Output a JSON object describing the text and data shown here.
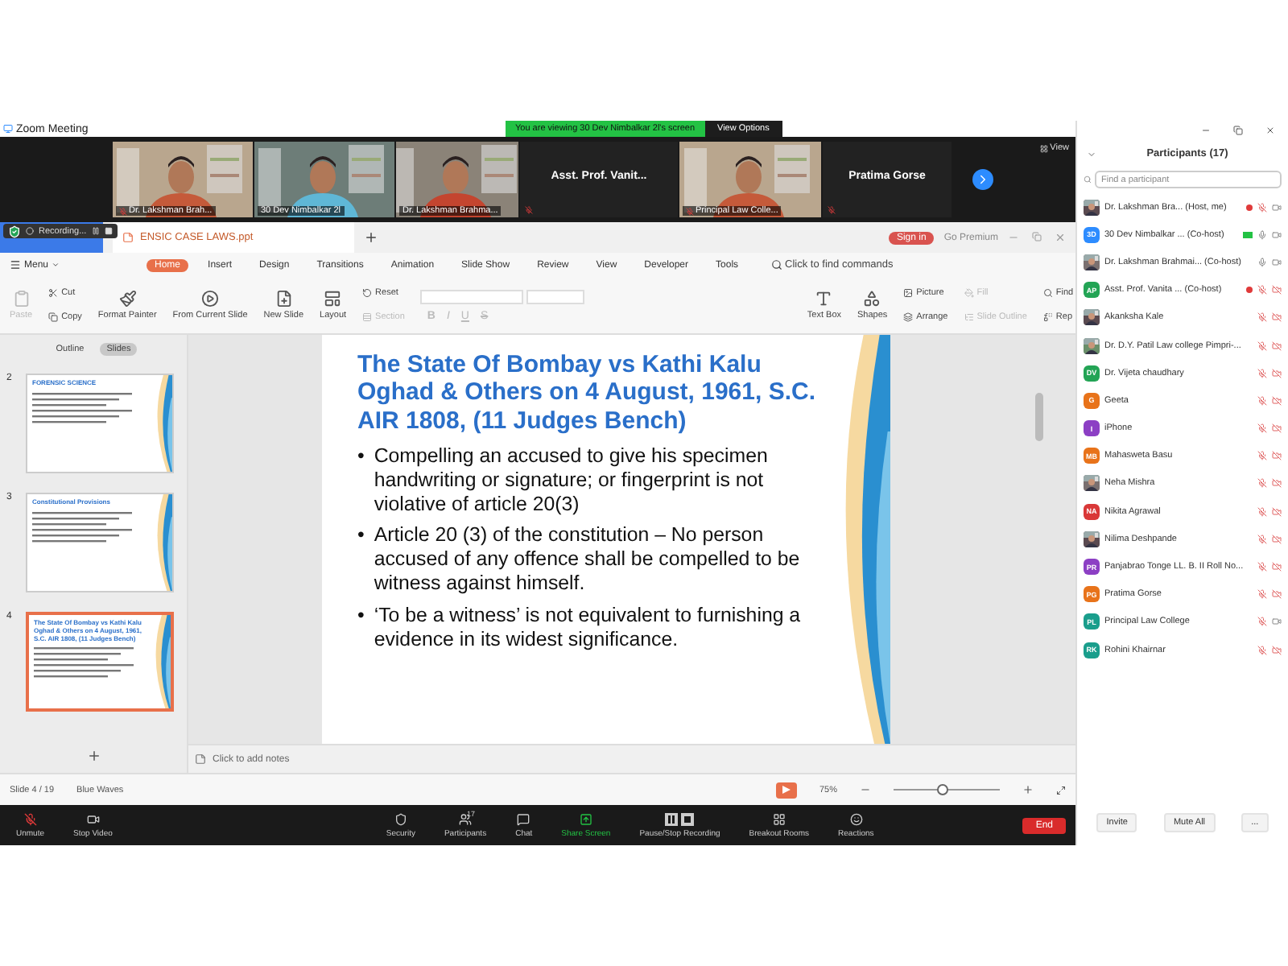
{
  "window": {
    "title": "Zoom Meeting",
    "banner": "You are viewing 30 Dev Nimbalkar 2l's screen",
    "view_options": "View Options",
    "view": "View"
  },
  "videos": [
    {
      "kind": "video",
      "name": "Dr. Lakshman Brah...",
      "muted": true
    },
    {
      "kind": "video",
      "name": "30 Dev Nimbalkar 2l",
      "muted": false
    },
    {
      "kind": "video",
      "name": "Dr. Lakshman Brahma...",
      "muted": false
    },
    {
      "kind": "name",
      "name": "Asst. Prof. Vanit...",
      "muted": true
    },
    {
      "kind": "video",
      "name": "Principal Law Colle...",
      "muted": true
    },
    {
      "kind": "name",
      "name": "Pratima Gorse",
      "muted": true
    }
  ],
  "recording": {
    "label": "Recording..."
  },
  "file_tab": {
    "label": "ENSIC CASE LAWS.ppt"
  },
  "sign_in": "Sign in",
  "premium": "Go Premium",
  "menu": "Menu",
  "ribbon_tabs": [
    {
      "label": "Home",
      "selected": true
    },
    {
      "label": "Insert",
      "selected": false
    },
    {
      "label": "Design",
      "selected": false
    },
    {
      "label": "Transitions",
      "selected": false
    },
    {
      "label": "Animation",
      "selected": false
    },
    {
      "label": "Slide Show",
      "selected": false
    },
    {
      "label": "Review",
      "selected": false
    },
    {
      "label": "View",
      "selected": false
    },
    {
      "label": "Developer",
      "selected": false
    },
    {
      "label": "Tools",
      "selected": false
    }
  ],
  "command_search": "Click to find commands",
  "tool_groups": [
    [
      {
        "kind": "paste",
        "label": "Paste",
        "disabled": true
      }
    ],
    [
      {
        "kind": "cut",
        "label": "Cut",
        "disabled": false
      },
      {
        "kind": "copy",
        "label": "Copy",
        "disabled": false
      }
    ],
    [
      {
        "kind": "painter",
        "label": "Format Painter",
        "disabled": false
      }
    ],
    [
      {
        "kind": "play",
        "label": "From Current Slide",
        "disabled": false
      }
    ],
    [
      {
        "kind": "slide",
        "label": "New Slide",
        "disabled": false
      }
    ],
    [
      {
        "kind": "layout",
        "label": "Layout",
        "disabled": false
      }
    ],
    [
      {
        "kind": "reset",
        "label": "Reset",
        "disabled": false
      },
      {
        "kind": "section",
        "label": "Section",
        "disabled": true
      }
    ],
    [
      {
        "kind": "font"
      }
    ],
    [
      {
        "kind": "textbox",
        "label": "Text Box",
        "disabled": false
      }
    ],
    [
      {
        "kind": "shapes",
        "label": "Shapes",
        "disabled": false
      }
    ],
    [
      {
        "kind": "picture",
        "label": "Picture",
        "disabled": false
      },
      {
        "kind": "arrange",
        "label": "Arrange",
        "disabled": false
      }
    ],
    [
      {
        "kind": "fill",
        "label": "Fill",
        "disabled": true
      },
      {
        "kind": "outline",
        "label": "Slide Outline",
        "disabled": true
      }
    ],
    [
      {
        "kind": "find",
        "label": "Find",
        "disabled": false
      },
      {
        "kind": "replace",
        "label": "Rep",
        "disabled": false
      }
    ]
  ],
  "format_glyphs": [
    "B",
    "I",
    "U",
    "S"
  ],
  "panel_tabs": [
    {
      "label": "Outline",
      "selected": false
    },
    {
      "label": "Slides",
      "selected": true
    }
  ],
  "thumbnails": [
    {
      "number": "2",
      "title": "FORENSIC SCIENCE",
      "selected": false
    },
    {
      "number": "3",
      "title": "Constitutional Provisions",
      "selected": false
    },
    {
      "number": "4",
      "title": "The State Of Bombay vs Kathi Kalu Oghad & Others on 4 August, 1961, S.C. AIR 1808, (11 Judges Bench)",
      "selected": true
    }
  ],
  "slide": {
    "title": "The State Of Bombay vs Kathi Kalu Oghad & Others on 4 August, 1961, S.C. AIR  1808, (11 Judges  Bench)",
    "bullets": [
      {
        "marker": "•",
        "text": "Compelling an accused to give his specimen handwriting or signature; or fingerprint is not violative of article 20(3)"
      },
      {
        "marker": "•",
        "text": "Article 20 (3) of the constitution – No person accused of any offence shall be compelled to be witness against himself."
      },
      {
        "marker": "•",
        "text": "‘To be a witness’ is not equivalent to furnishing a evidence in its widest significance."
      }
    ]
  },
  "notes_placeholder": "Click to add notes",
  "status_bar": {
    "slide": "Slide 4 / 19",
    "theme": "Blue Waves",
    "zoom": "75%",
    "zoom_level": {
      "level": 0.45
    }
  },
  "toolbar": [
    {
      "kind": "mic",
      "label": "Unmute"
    },
    {
      "kind": "video",
      "label": "Stop Video"
    },
    {
      "kind": "security",
      "label": "Security"
    },
    {
      "kind": "participants",
      "label": "Participants",
      "count": "17"
    },
    {
      "kind": "chat",
      "label": "Chat"
    },
    {
      "kind": "share",
      "label": "Share Screen"
    },
    {
      "kind": "record",
      "label": "Pause/Stop Recording"
    },
    {
      "kind": "breakout",
      "label": "Breakout Rooms"
    },
    {
      "kind": "reactions",
      "label": "Reactions"
    }
  ],
  "end": "End",
  "participants": {
    "title": "Participants (17)",
    "search": {
      "placeholder": "Find a participant"
    },
    "items": [
      {
        "name": "Dr. Lakshman Bra...",
        "role": "(Host, me)",
        "recording": true,
        "sharing": false,
        "muted": true,
        "video_off": false
      },
      {
        "name": "30 Dev Nimbalkar ...",
        "role": "(Co-host)",
        "kind": "initials",
        "initials": "3D",
        "color": "#2d8cff",
        "recording": false,
        "sharing": true,
        "muted": false,
        "video_off": false
      },
      {
        "name": "Dr. Lakshman Brahmai...",
        "role": "(Co-host)",
        "recording": false,
        "sharing": false,
        "muted": false,
        "video_off": false
      },
      {
        "name": "Asst. Prof. Vanita ...",
        "role": "(Co-host)",
        "kind": "initials",
        "initials": "AP",
        "color": "#23a455",
        "recording": true,
        "sharing": false,
        "muted": true,
        "video_off": true
      },
      {
        "name": "Akanksha Kale",
        "recording": false,
        "sharing": false,
        "muted": true,
        "video_off": true
      },
      {
        "name": "Dr. D.Y. Patil Law college Pimpri-...",
        "recording": false,
        "sharing": false,
        "muted": true,
        "video_off": true
      },
      {
        "name": "Dr. Vijeta chaudhary",
        "kind": "initials",
        "initials": "DV",
        "color": "#23a455",
        "recording": false,
        "sharing": false,
        "muted": true,
        "video_off": true
      },
      {
        "name": "Geeta",
        "kind": "initials",
        "initials": "G",
        "color": "#e8731a",
        "recording": false,
        "sharing": false,
        "muted": true,
        "video_off": true
      },
      {
        "name": "iPhone",
        "kind": "initials",
        "initials": "I",
        "color": "#8c3fc4",
        "recording": false,
        "sharing": false,
        "muted": true,
        "video_off": true
      },
      {
        "name": "Mahasweta Basu",
        "kind": "initials",
        "initials": "MB",
        "color": "#e8731a",
        "recording": false,
        "sharing": false,
        "muted": true,
        "video_off": true
      },
      {
        "name": "Neha Mishra",
        "recording": false,
        "sharing": false,
        "muted": true,
        "video_off": true
      },
      {
        "name": "Nikita Agrawal",
        "kind": "initials",
        "initials": "NA",
        "color": "#d93838",
        "recording": false,
        "sharing": false,
        "muted": true,
        "video_off": true
      },
      {
        "name": "Nilima Deshpande",
        "recording": false,
        "sharing": false,
        "muted": true,
        "video_off": true
      },
      {
        "name": "Panjabrao Tonge LL. B. II Roll No...",
        "kind": "initials",
        "initials": "PR",
        "color": "#8c3fc4",
        "recording": false,
        "sharing": false,
        "muted": true,
        "video_off": true
      },
      {
        "name": "Pratima Gorse",
        "kind": "initials",
        "initials": "PG",
        "color": "#e8731a",
        "recording": false,
        "sharing": false,
        "muted": true,
        "video_off": true
      },
      {
        "name": "Principal Law College",
        "kind": "initials",
        "initials": "PL",
        "color": "#1a9e8c",
        "recording": false,
        "sharing": false,
        "muted": true,
        "video_off": false
      },
      {
        "name": "Rohini Khairnar",
        "kind": "initials",
        "initials": "RK",
        "color": "#1a9e8c",
        "recording": false,
        "sharing": false,
        "muted": true,
        "video_off": true
      }
    ],
    "buttons": [
      "Invite",
      "Mute All",
      "..."
    ]
  }
}
